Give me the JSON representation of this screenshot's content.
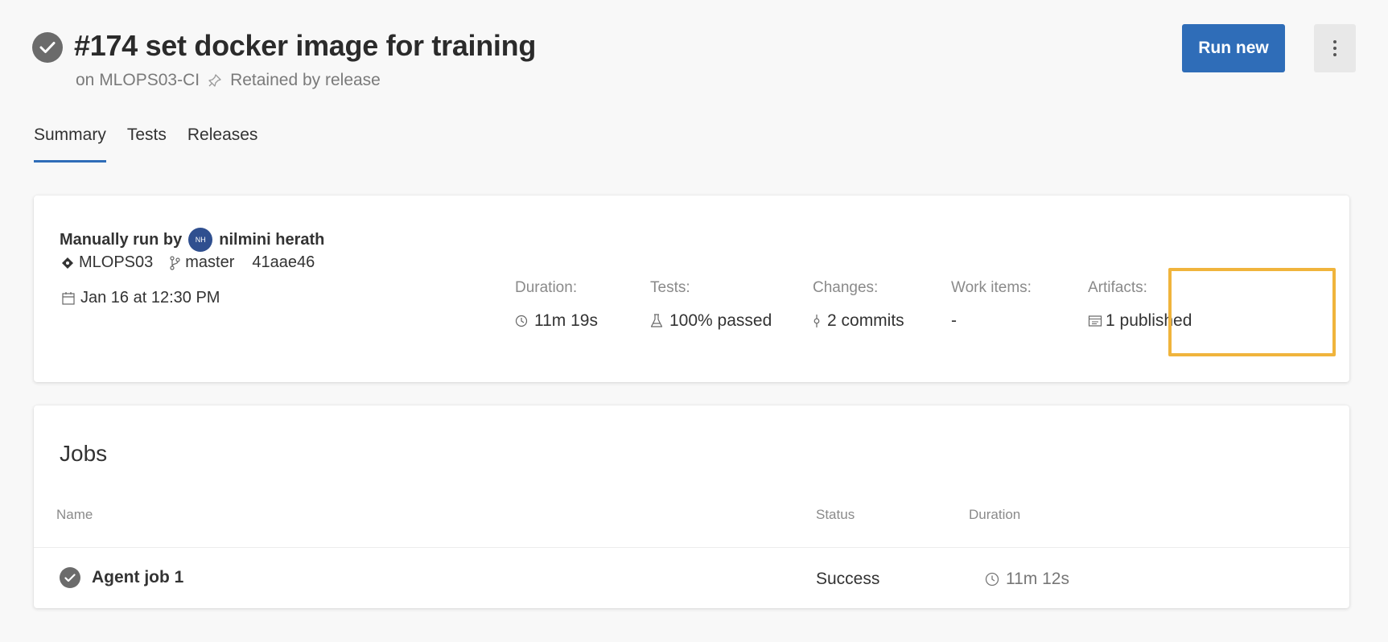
{
  "header": {
    "title": "#174 set docker image for training",
    "pipeline": "on MLOPS03-CI",
    "retention": "Retained by release",
    "run_new_label": "Run new",
    "status_icon": "check-circle-icon"
  },
  "tabs": [
    {
      "label": "Summary",
      "active": true
    },
    {
      "label": "Tests",
      "active": false
    },
    {
      "label": "Releases",
      "active": false
    }
  ],
  "summary": {
    "run_by_prefix": "Manually run by",
    "user_initials": "NH",
    "user_name": "nilmini herath",
    "repo": "MLOPS03",
    "branch": "master",
    "commit": "41aae46",
    "date": "Jan 16 at 12:30 PM",
    "stats": [
      {
        "label": "Duration:",
        "value": "11m 19s",
        "icon": "clock-icon"
      },
      {
        "label": "Tests:",
        "value": "100% passed",
        "icon": "flask-icon"
      },
      {
        "label": "Changes:",
        "value": "2 commits",
        "icon": "commit-icon"
      },
      {
        "label": "Work items:",
        "value": "-",
        "icon": ""
      },
      {
        "label": "Artifacts:",
        "value": "1 published",
        "icon": "artifact-icon"
      }
    ],
    "highlight_color": "#f0b43c"
  },
  "jobs": {
    "title": "Jobs",
    "columns": [
      "Name",
      "Status",
      "Duration"
    ],
    "rows": [
      {
        "name": "Agent job 1",
        "status": "Success",
        "duration": "11m 12s"
      }
    ]
  },
  "colors": {
    "accent": "#2f6db8",
    "success_icon": "#6b6b6b"
  }
}
